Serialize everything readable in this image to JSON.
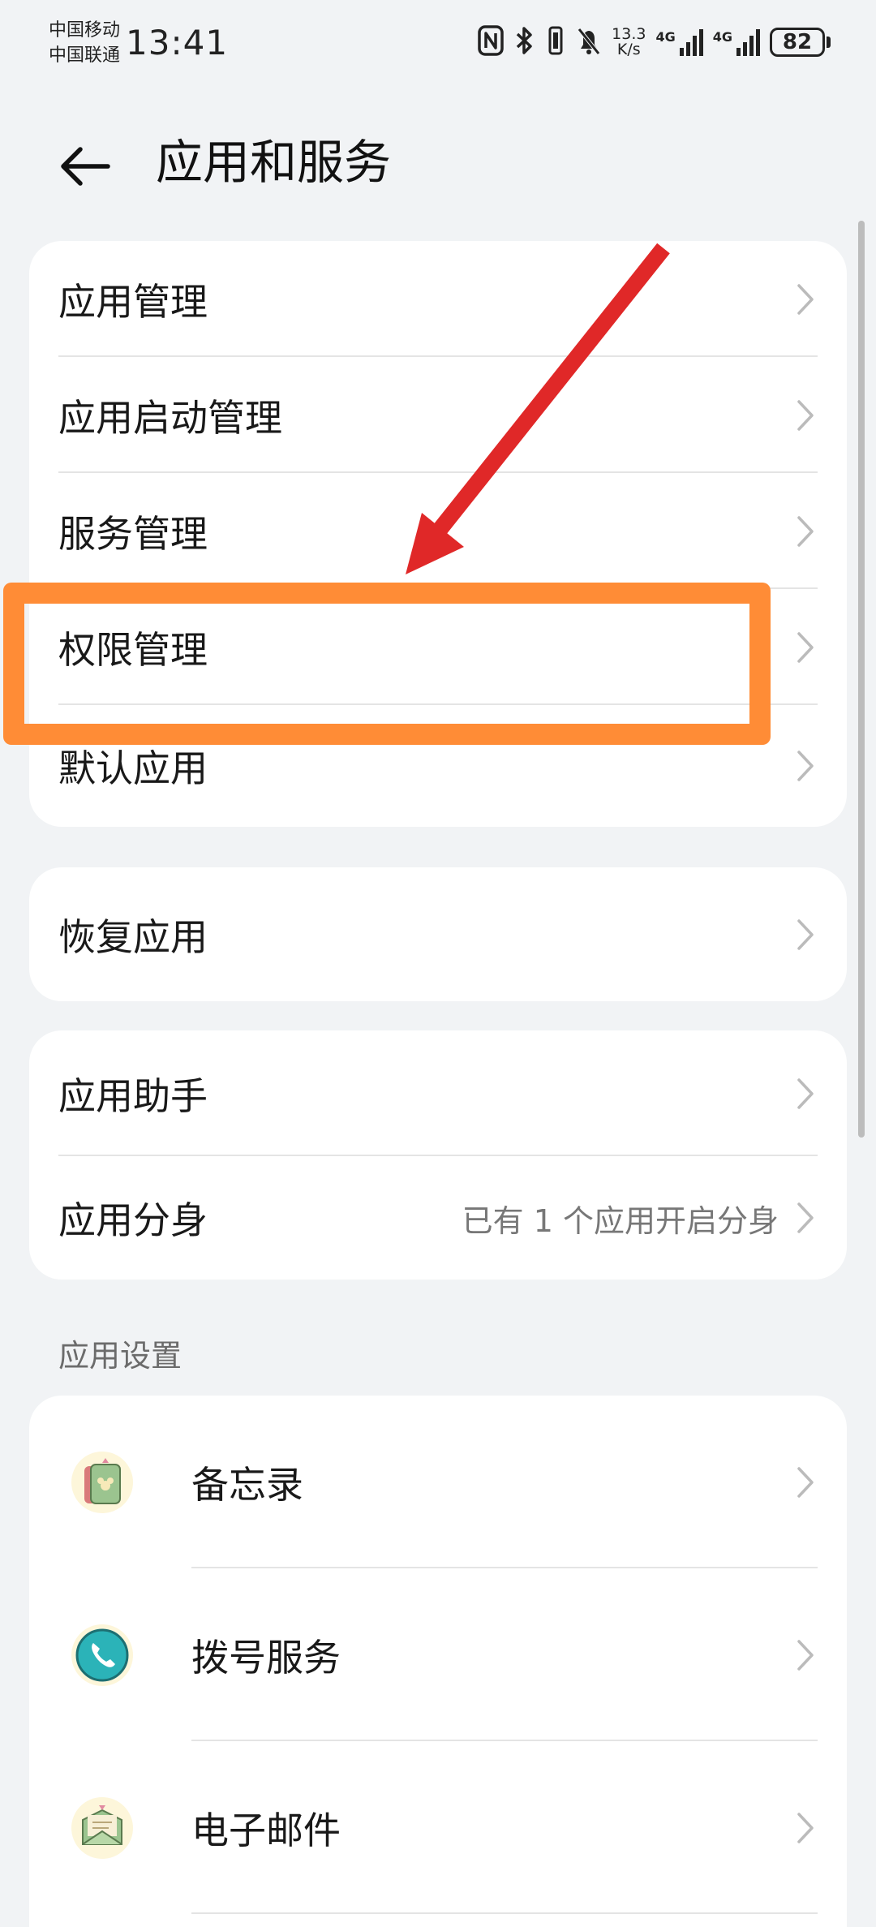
{
  "status_bar": {
    "carrier_1": "中国移动",
    "carrier_2": "中国联通",
    "time": "13:41",
    "net_speed_value": "13.3",
    "net_speed_unit": "K/s",
    "signal_1_label": "4G",
    "signal_2_label": "4G",
    "battery": "82",
    "icons": [
      "nfc-icon",
      "bluetooth-icon",
      "vibrate-icon",
      "bell-off-icon",
      "signal-icon",
      "battery-icon"
    ]
  },
  "header": {
    "title": "应用和服务",
    "back_icon": "back-arrow-icon"
  },
  "group1": {
    "items": [
      {
        "label": "应用管理"
      },
      {
        "label": "应用启动管理"
      },
      {
        "label": "服务管理"
      },
      {
        "label": "权限管理"
      },
      {
        "label": "默认应用"
      }
    ]
  },
  "group2": {
    "items": [
      {
        "label": "恢复应用"
      }
    ]
  },
  "group3": {
    "items": [
      {
        "label": "应用助手"
      },
      {
        "label": "应用分身",
        "value": "已有 1 个应用开启分身"
      }
    ]
  },
  "app_settings": {
    "section_title": "应用设置",
    "apps": [
      {
        "label": "备忘录",
        "icon": "notepad-icon"
      },
      {
        "label": "拨号服务",
        "icon": "phone-icon"
      },
      {
        "label": "电子邮件",
        "icon": "email-icon"
      }
    ]
  },
  "colors": {
    "background": "#f1f3f5",
    "card": "#ffffff",
    "highlight": "#ff8c36",
    "arrow": "#e02828"
  }
}
